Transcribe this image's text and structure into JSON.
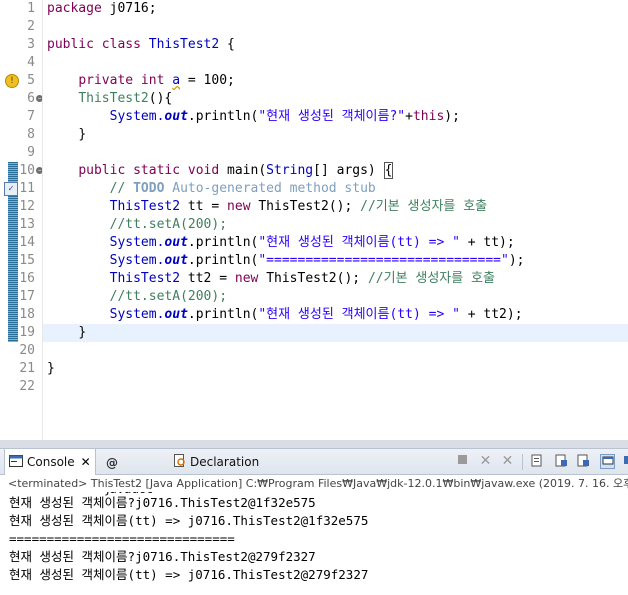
{
  "editor": {
    "line_numbers": [
      "1",
      "2",
      "3",
      "4",
      "5",
      "6",
      "7",
      "8",
      "9",
      "10",
      "11",
      "12",
      "13",
      "14",
      "15",
      "16",
      "17",
      "18",
      "19",
      "20",
      "21",
      "22"
    ],
    "lines": {
      "l1_kw": "package",
      "l1_rest": " j0716;",
      "l3_kw": "public class ",
      "l3_cls": "ThisTest2",
      "l3_rest": " {",
      "l5_kw": "private int ",
      "l5_field": "a",
      "l5_rest": " = 100;",
      "l6_cls": "ThisTest2",
      "l6_rest": "(){",
      "l7_sys": "System.",
      "l7_out": "out",
      "l7_mid": ".println(",
      "l7_str": "\"현재 생성된 객체이름?\"",
      "l7_plus": "+",
      "l7_this": "this",
      "l7_end": ");",
      "l8": "}",
      "l10_kw": "public static void ",
      "l10_name": "main(",
      "l10_type": "String",
      "l10_args": "[] args) ",
      "l10_brace": "{",
      "l11_com1": "// ",
      "l11_todo": "TODO",
      "l11_com2": " Auto-generated method stub",
      "l12_cls": "ThisTest2",
      "l12_var": " tt = ",
      "l12_new": "new ",
      "l12_cls2": "ThisTest2",
      "l12_end": "(); ",
      "l12_com": "//기본 생성자를 호출",
      "l13_com": "//tt.setA(200);",
      "l14_sys": "System.",
      "l14_out": "out",
      "l14_mid": ".println(",
      "l14_str": "\"현재 생성된 객체이름(tt) => \"",
      "l14_end": " + tt);",
      "l15_sys": "System.",
      "l15_out": "out",
      "l15_mid": ".println(",
      "l15_str": "\"==============================\"",
      "l15_end": ");",
      "l16_cls": "ThisTest2",
      "l16_var": " tt2 = ",
      "l16_new": "new ",
      "l16_cls2": "ThisTest2",
      "l16_end": "(); ",
      "l16_com": "//기본 생성자를 호출",
      "l17_com": "//tt.setA(200);",
      "l18_sys": "System.",
      "l18_out": "out",
      "l18_mid": ".println(",
      "l18_str": "\"현재 생성된 객체이름(tt) => \"",
      "l18_end": " + tt2);",
      "l19": "}",
      "l21": "}"
    }
  },
  "console": {
    "tabs": {
      "console_label": "Console",
      "javadoc_label": "Javadoc",
      "declaration_label": "Declaration"
    },
    "status": "<terminated> ThisTest2 [Java Application] C:₩Program Files₩Java₩jdk-12.0.1₩bin₩javaw.exe (2019. 7. 16. 오후 3:",
    "output": [
      "현재 생성된 객체이름?j0716.ThisTest2@1f32e575",
      "현재 생성된 객체이름(tt) => j0716.ThisTest2@1f32e575",
      "==============================",
      "현재 생성된 객체이름?j0716.ThisTest2@279f2327",
      "현재 생성된 객체이름(tt) => j0716.ThisTest2@279f2327"
    ]
  },
  "colors": {
    "keyword": "#7f0055",
    "string": "#2a00ff",
    "comment": "#3f7f5f",
    "field": "#0000c0",
    "current_line": "#e8f2fe"
  }
}
